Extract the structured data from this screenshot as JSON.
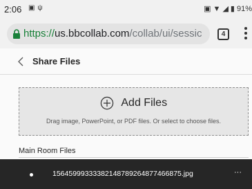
{
  "status_bar": {
    "time": "2:06",
    "left_icons": [
      "image-notification-icon",
      "usb-icon"
    ],
    "battery_text": "91%",
    "right_icons": [
      "vibrate-icon",
      "wifi-icon",
      "signal-icon",
      "battery-icon"
    ]
  },
  "browser": {
    "url_scheme": "https://",
    "url_host": "us.bbcollab.com",
    "url_path": "/collab/ui/sessic",
    "tab_count": "4",
    "secure_color": "#188038"
  },
  "header": {
    "title": "Share Files"
  },
  "dropzone": {
    "title": "Add Files",
    "subtitle": "Drag image, PowerPoint, or PDF files. Or select to choose files."
  },
  "files_section": {
    "label": "Main Room Files",
    "files": [
      {
        "name": "1564599933338214878926487746687​5.jpg",
        "more": "···"
      }
    ]
  }
}
